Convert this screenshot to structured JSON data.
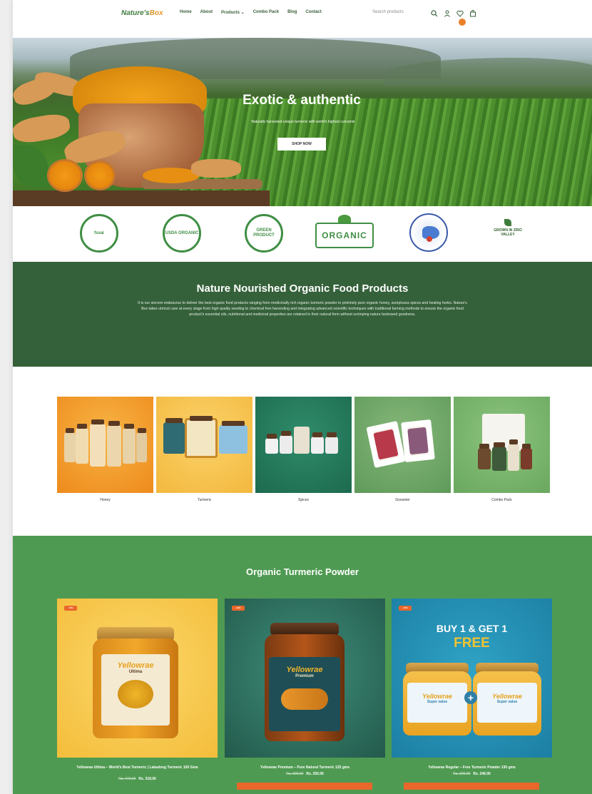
{
  "header": {
    "logo_part1": "Nature's",
    "logo_part2": "Box",
    "nav": [
      "Home",
      "About",
      "Products",
      "Combo Pack",
      "Blog",
      "Contact"
    ],
    "products_caret": "⌄",
    "search_placeholder": "Search products",
    "cart_count": ""
  },
  "hero": {
    "title": "Exotic & authentic",
    "subtitle": "Naturally harvested unique turmeric with world's highest curcumin",
    "button": "SHOP NOW"
  },
  "certifications": {
    "fssai": "fssai",
    "usda": "USDA ORGANIC",
    "green": "GREEN PRODUCT",
    "organic": "ORGANIC",
    "grown_in": "GROWN IN ZIRO VALLEY"
  },
  "intro": {
    "title": "Nature Nourished Organic Food Products",
    "text": "It is our sincere endeavour to deliver the best organic food products ranging from medicinally rich organic turmeric powder to pristinely pure organic honey, sumptuous spices and healing herbs. Nature's Box takes utmost care at every stage from high quality seeding to chemical free harvesting and integrating advanced scientific techniques with traditional farming methods to ensure the organic food product's essential oils, nutritional and medicinal properties are retained in their natural form without scrimping nature bestowed goodness."
  },
  "categories": [
    {
      "label": "Honey"
    },
    {
      "label": "Turmeric"
    },
    {
      "label": "Spices"
    },
    {
      "label": "Gooseter"
    },
    {
      "label": "Combo Pack"
    }
  ],
  "products_section": {
    "title": "Organic Turmeric Powder",
    "badge": "-10%",
    "items": [
      {
        "name": "Yellowrae Ultima – World's Best Turmeric | Lakadong Turmeric 100 Gms",
        "old_price": "Rs. 470.00",
        "price": "Rs. 318.00",
        "brand": "Yellowrae",
        "variant": "Ultima"
      },
      {
        "name": "Yellowrae Premium – Pure Natural Turmeric 125 gms",
        "old_price": "Rs. 300.00",
        "price": "Rs. 292.00",
        "brand": "Yellowrae",
        "variant": "Premium"
      },
      {
        "name": "Yellowrae Regular – Free Turmeric Powder 130 gms",
        "old_price": "Rs. 325.00",
        "price": "Rs. 246.00",
        "brand": "Yellowrae",
        "variant": "Super value",
        "promo_line1": "BUY 1 & GET 1",
        "promo_line2": "FREE"
      }
    ]
  },
  "colors": {
    "brand_green": "#35613a",
    "section_green": "#4f9a52",
    "accent_orange": "#e9672a"
  }
}
